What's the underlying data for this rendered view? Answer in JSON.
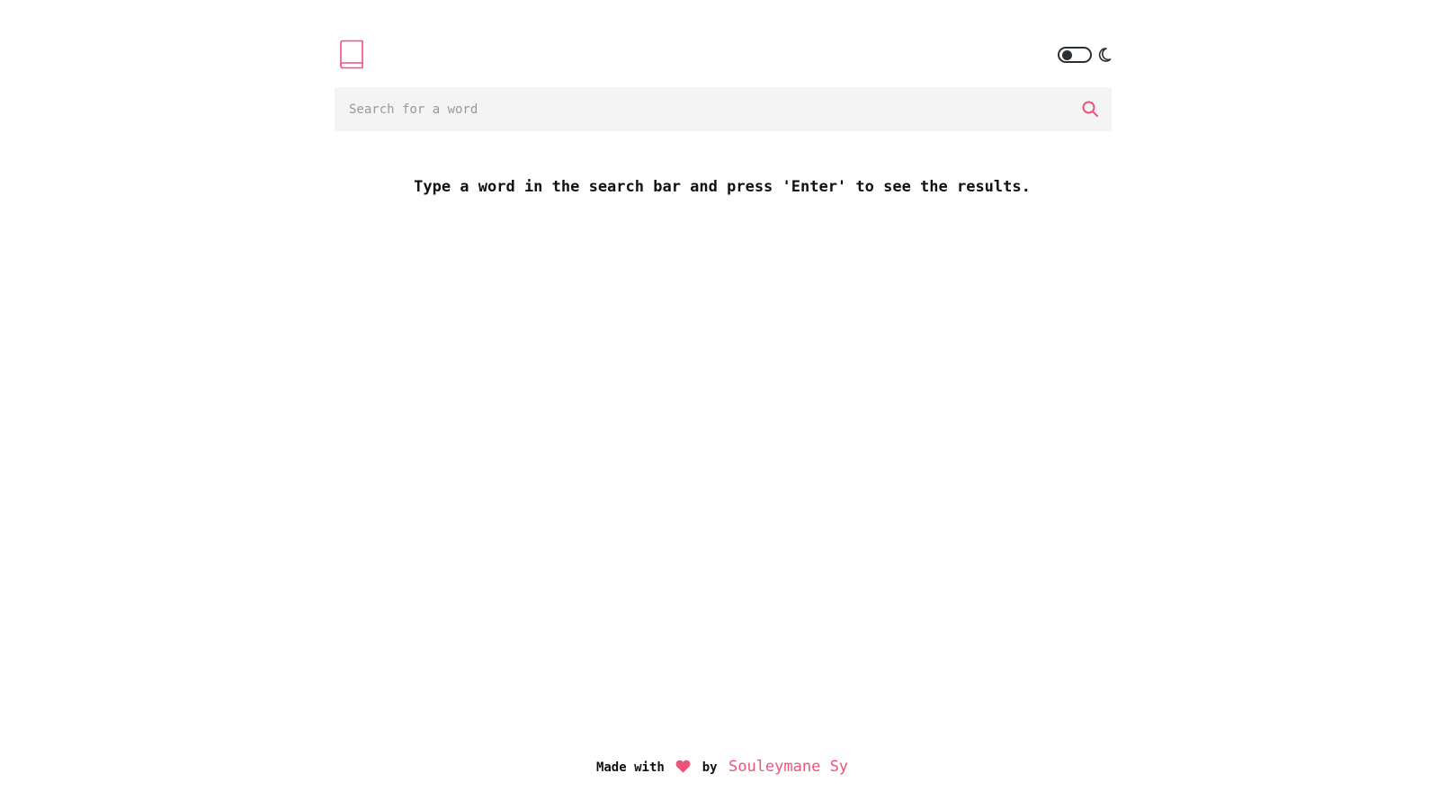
{
  "app": {
    "logo_icon": "book-icon",
    "accent_color": "#e9557a"
  },
  "theme": {
    "toggle_state": "off",
    "mode_icon": "moon-icon"
  },
  "search": {
    "placeholder": "Search for a word",
    "value": "",
    "button_icon": "search-icon"
  },
  "main": {
    "hint": "Type a word in the search bar and press 'Enter' to see the results."
  },
  "footer": {
    "made_with": "Made with",
    "heart_icon": "heart-icon",
    "by": "by",
    "author": "Souleymane Sy"
  }
}
